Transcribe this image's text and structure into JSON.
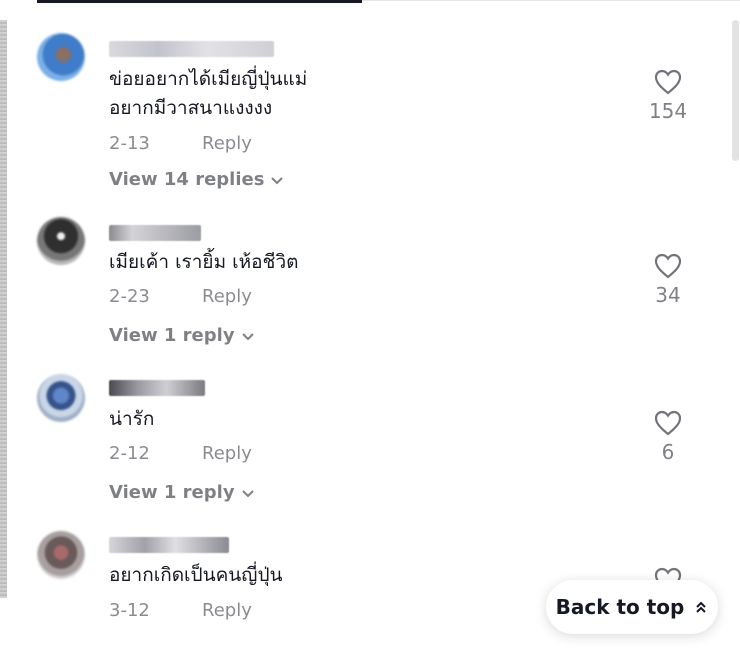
{
  "comments": [
    {
      "text": "ข่อยอยากได้เมียญี่ปุ่นแม่\nอยากมีวาสนาแงงงง",
      "date": "2-13",
      "reply_label": "Reply",
      "view_replies": "View 14 replies",
      "likes": "154"
    },
    {
      "text": "เมียเค้า เรายิ้ม เห้อชีวิต",
      "date": "2-23",
      "reply_label": "Reply",
      "view_replies": "View 1 reply",
      "likes": "34"
    },
    {
      "text": "น่ารัก",
      "date": "2-12",
      "reply_label": "Reply",
      "view_replies": "View 1 reply",
      "likes": "6"
    },
    {
      "text": "อยากเกิดเป็นคนญี่ปุ่น",
      "date": "3-12",
      "reply_label": "Reply",
      "view_replies": "",
      "likes": ""
    }
  ],
  "back_to_top": {
    "label": "Back to top",
    "icon": "double-chevron-up-icon"
  },
  "icons": {
    "like": "heart-outline-icon",
    "expand": "chevron-down-icon"
  },
  "colors": {
    "text": "#161823",
    "secondary": "#8a8b91"
  }
}
